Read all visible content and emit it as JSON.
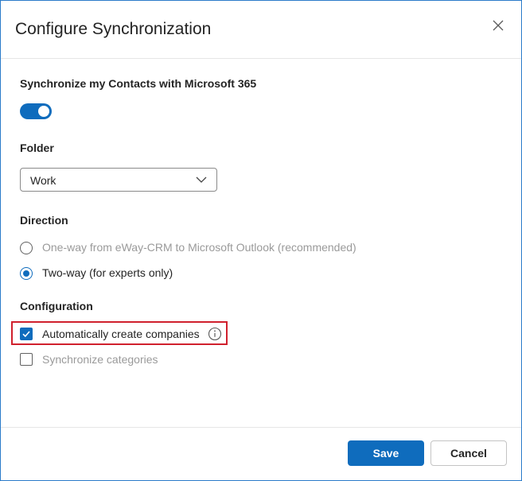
{
  "dialog": {
    "title": "Configure Synchronization"
  },
  "sync": {
    "label": "Synchronize my Contacts with Microsoft 365",
    "enabled": true
  },
  "folder": {
    "label": "Folder",
    "selected": "Work"
  },
  "direction": {
    "label": "Direction",
    "options": [
      {
        "label": "One-way from eWay-CRM to Microsoft Outlook (recommended)",
        "selected": false,
        "disabled": true
      },
      {
        "label": "Two-way (for experts only)",
        "selected": true,
        "disabled": false
      }
    ]
  },
  "configuration": {
    "label": "Configuration",
    "options": [
      {
        "label": "Automatically create companies",
        "checked": true,
        "disabled": false
      },
      {
        "label": "Synchronize categories",
        "checked": false,
        "disabled": true
      }
    ]
  },
  "footer": {
    "save_label": "Save",
    "cancel_label": "Cancel"
  },
  "colors": {
    "accent": "#0f6cbd",
    "highlight": "#d0202d",
    "muted": "#9a9a9a"
  },
  "icons": {
    "close": "close-icon",
    "chevron": "chevron-down-icon",
    "info": "info-icon",
    "check": "checkmark-icon"
  }
}
